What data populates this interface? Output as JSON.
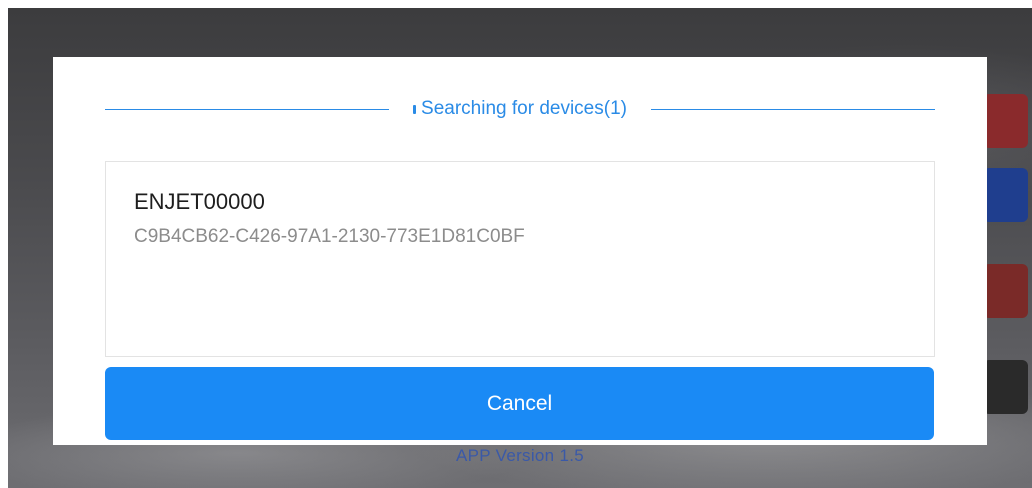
{
  "background": {
    "version_text": "APP Version   1.5"
  },
  "dialog": {
    "title": "Searching for devices(1)",
    "devices": [
      {
        "name": "ENJET00000",
        "id": "C9B4CB62-C426-97A1-2130-773E1D81C0BF"
      }
    ],
    "cancel_label": "Cancel"
  },
  "colors": {
    "accent": "#1a8af5",
    "title": "#2a8be6"
  }
}
